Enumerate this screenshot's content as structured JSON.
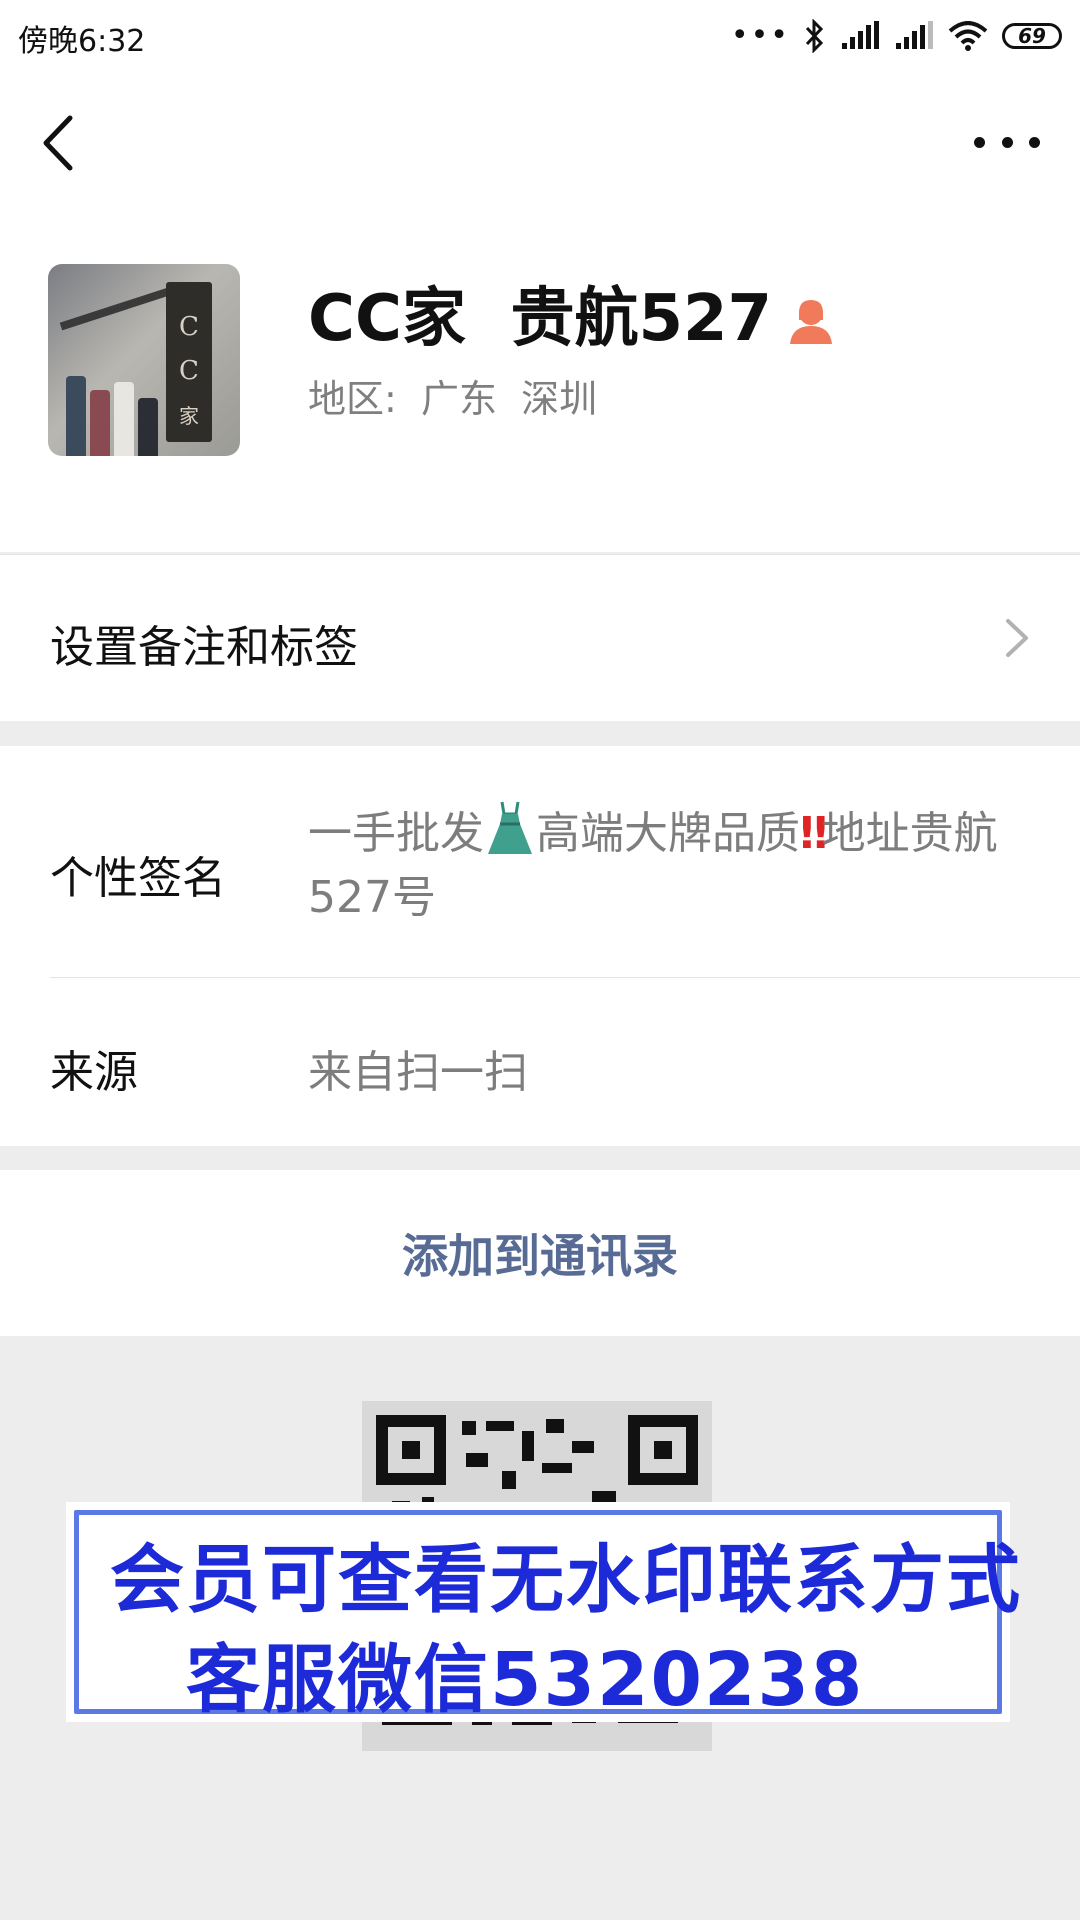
{
  "status_bar": {
    "time": "傍晚6:32",
    "dots": "•••",
    "battery": "69",
    "icons": [
      "bluetooth-icon",
      "signal-icon",
      "signal-icon",
      "wifi-icon",
      "battery-icon"
    ]
  },
  "nav": {
    "back_icon": "chevron-left-icon",
    "more_icon": "more-dots-icon"
  },
  "profile": {
    "name": "CC家  贵航527",
    "gender_icon": "female-user-icon",
    "region": "地区:  广东  深圳",
    "avatar_text": [
      "C",
      "C",
      "家"
    ]
  },
  "remark": {
    "label": "设置备注和标签"
  },
  "signature": {
    "label": "个性签名",
    "text_part1": "一手批发",
    "text_part2": "高端大牌品质",
    "text_part3": "地址贵航527号",
    "dress_icon": "dress-icon",
    "exclaim": "‼"
  },
  "source": {
    "label": "来源",
    "value": "来自扫一扫"
  },
  "actions": {
    "add_contacts": "添加到通讯录"
  },
  "watermark": {
    "line1": "会员可查看无水印联系方式",
    "line2": "客服微信5320238"
  },
  "colors": {
    "accent": "#576b95",
    "watermark": "#1c2ad8",
    "background": "#ededed"
  }
}
